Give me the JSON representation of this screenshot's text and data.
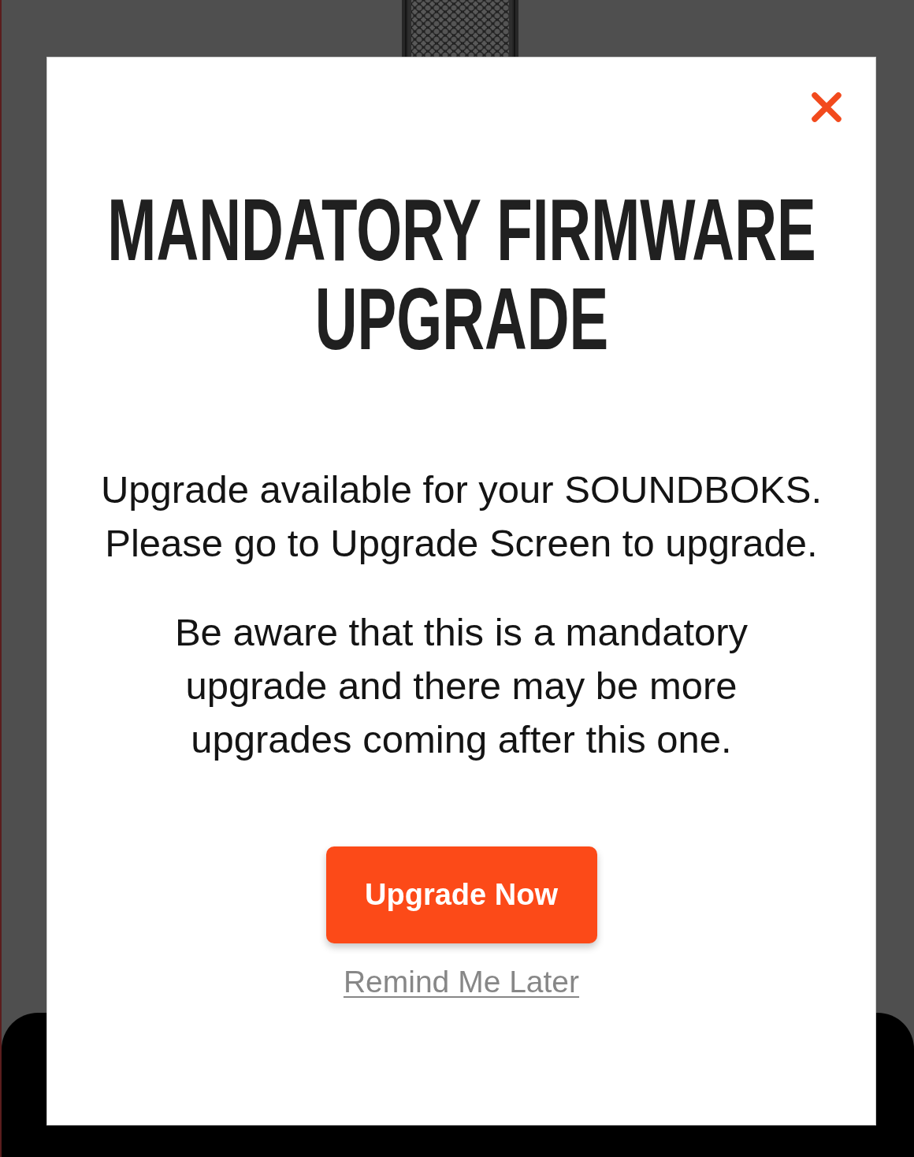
{
  "dialog": {
    "title": "MANDATORY FIRMWARE UPGRADE",
    "paragraphs": [
      "Upgrade available for your SOUNDBOKS. Please go to Upgrade Screen to upgrade.",
      "Be aware that this is a mandatory upgrade and there may be more upgrades coming after this one."
    ],
    "primary_button": "Upgrade Now",
    "secondary_link": "Remind Me Later"
  }
}
